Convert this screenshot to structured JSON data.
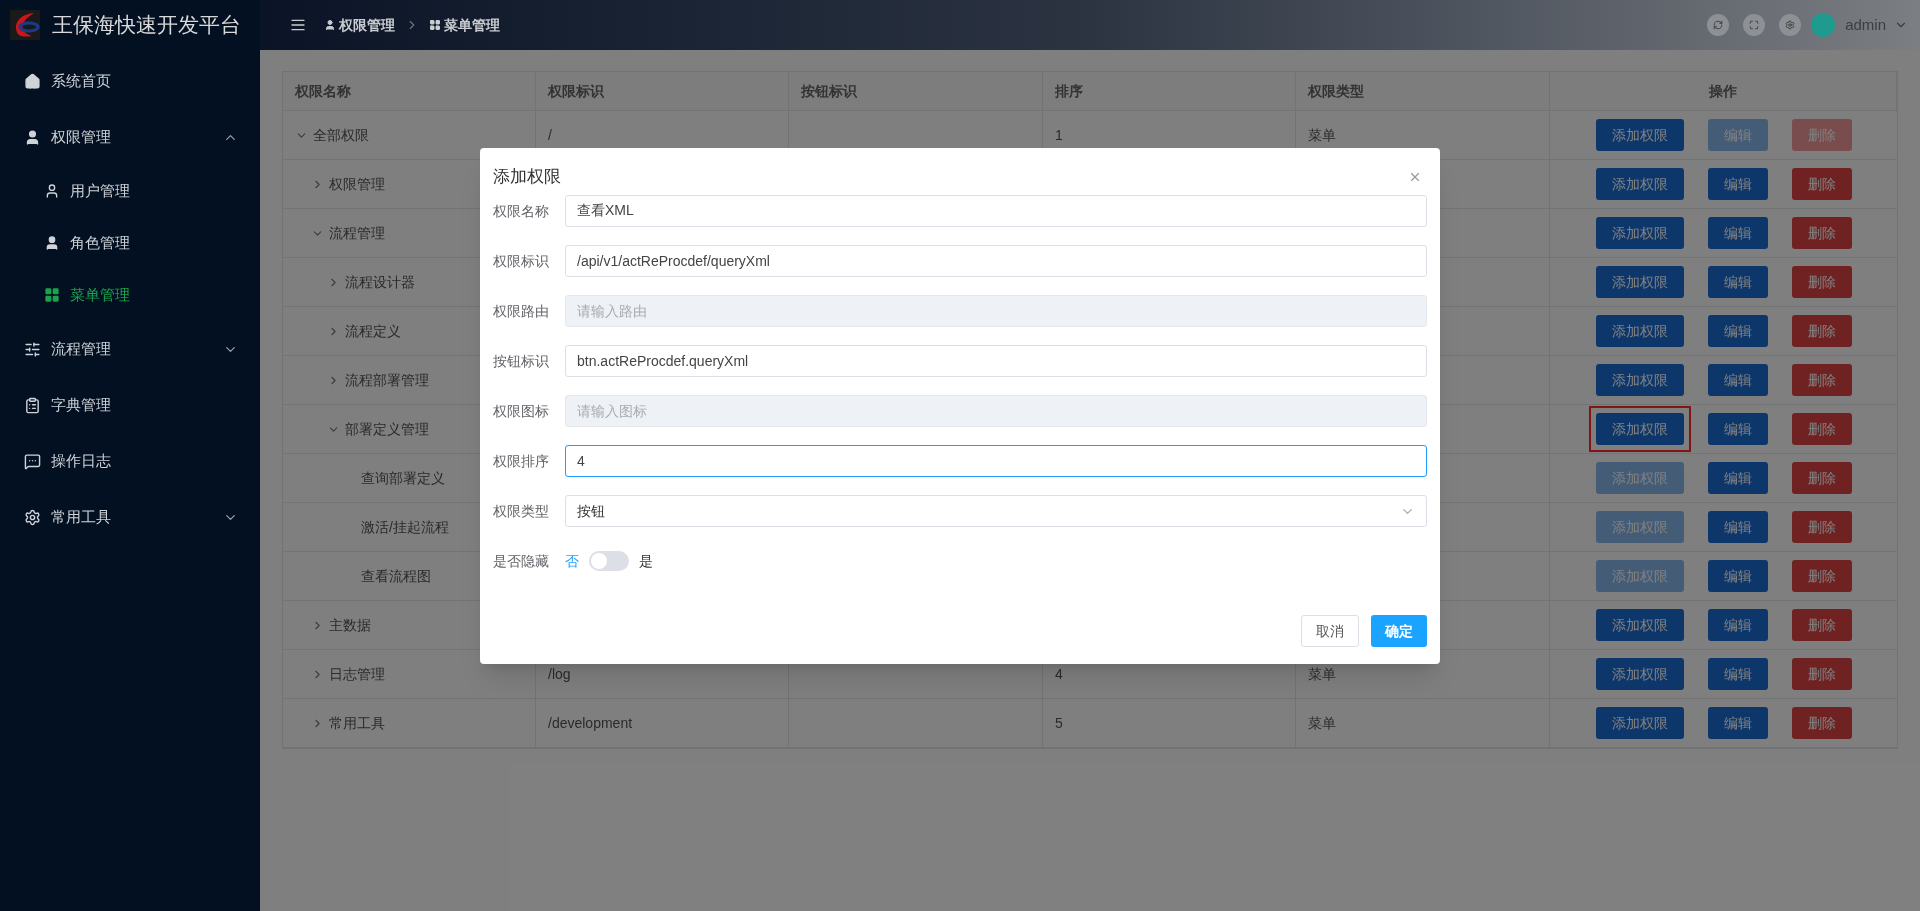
{
  "app": {
    "title": "王保海快速开发平台"
  },
  "header": {
    "breadcrumb": [
      {
        "label": "权限管理"
      },
      {
        "label": "菜单管理"
      }
    ],
    "user": {
      "name": "admin"
    }
  },
  "sidebar": {
    "items": [
      {
        "label": "系统首页",
        "selected": false
      },
      {
        "label": "权限管理",
        "selected": false,
        "expanded": true,
        "children": [
          {
            "label": "用户管理",
            "selected": false
          },
          {
            "label": "角色管理",
            "selected": false
          },
          {
            "label": "菜单管理",
            "selected": true
          }
        ]
      },
      {
        "label": "流程管理",
        "selected": false,
        "expanded": false
      },
      {
        "label": "字典管理",
        "selected": false
      },
      {
        "label": "操作日志",
        "selected": false
      },
      {
        "label": "常用工具",
        "selected": false,
        "expanded": false
      }
    ]
  },
  "table": {
    "columns": [
      "权限名称",
      "权限标识",
      "按钮标识",
      "排序",
      "权限类型",
      "操作"
    ],
    "rows": [
      {
        "name": "全部权限",
        "expanded": true,
        "path": "/",
        "sort": "1",
        "type": "菜单",
        "actions": [
          {
            "label": "添加权限",
            "kind": "primary",
            "disabled": false,
            "highlighted": false
          },
          {
            "label": "编辑",
            "kind": "primary",
            "disabled": true,
            "highlighted": false
          },
          {
            "label": "删除",
            "kind": "danger",
            "disabled": true,
            "highlighted": false
          }
        ],
        "children": [
          {
            "name": "权限管理",
            "expanded": false,
            "actions": [
              {
                "label": "添加权限",
                "kind": "primary",
                "disabled": false,
                "highlighted": false
              },
              {
                "label": "编辑",
                "kind": "primary",
                "disabled": false,
                "highlighted": false
              },
              {
                "label": "删除",
                "kind": "danger",
                "disabled": false,
                "highlighted": false
              }
            ]
          },
          {
            "name": "流程管理",
            "expanded": true,
            "actions": [
              {
                "label": "添加权限",
                "kind": "primary",
                "disabled": false,
                "highlighted": false
              },
              {
                "label": "编辑",
                "kind": "primary",
                "disabled": false,
                "highlighted": false
              },
              {
                "label": "删除",
                "kind": "danger",
                "disabled": false,
                "highlighted": false
              }
            ],
            "children": [
              {
                "name": "流程设计器",
                "expanded": false,
                "actions": [
                  {
                    "label": "添加权限",
                    "kind": "primary",
                    "disabled": false,
                    "highlighted": false
                  },
                  {
                    "label": "编辑",
                    "kind": "primary",
                    "disabled": false,
                    "highlighted": false
                  },
                  {
                    "label": "删除",
                    "kind": "danger",
                    "disabled": false,
                    "highlighted": false
                  }
                ]
              },
              {
                "name": "流程定义",
                "expanded": false,
                "actions": [
                  {
                    "label": "添加权限",
                    "kind": "primary",
                    "disabled": false,
                    "highlighted": false
                  },
                  {
                    "label": "编辑",
                    "kind": "primary",
                    "disabled": false,
                    "highlighted": false
                  },
                  {
                    "label": "删除",
                    "kind": "danger",
                    "disabled": false,
                    "highlighted": false
                  }
                ]
              },
              {
                "name": "流程部署管理",
                "expanded": false,
                "actions": [
                  {
                    "label": "添加权限",
                    "kind": "primary",
                    "disabled": false,
                    "highlighted": false
                  },
                  {
                    "label": "编辑",
                    "kind": "primary",
                    "disabled": false,
                    "highlighted": false
                  },
                  {
                    "label": "删除",
                    "kind": "danger",
                    "disabled": false,
                    "highlighted": false
                  }
                ]
              },
              {
                "name": "部署定义管理",
                "expanded": true,
                "actions": [
                  {
                    "label": "添加权限",
                    "kind": "primary",
                    "disabled": false,
                    "highlighted": true
                  },
                  {
                    "label": "编辑",
                    "kind": "primary",
                    "disabled": false,
                    "highlighted": false
                  },
                  {
                    "label": "删除",
                    "kind": "danger",
                    "disabled": false,
                    "highlighted": false
                  }
                ],
                "children": [
                  {
                    "name": "查询部署定义",
                    "actions": [
                      {
                        "label": "添加权限",
                        "kind": "primary",
                        "disabled": true,
                        "highlighted": false
                      },
                      {
                        "label": "编辑",
                        "kind": "primary",
                        "disabled": false,
                        "highlighted": false
                      },
                      {
                        "label": "删除",
                        "kind": "danger",
                        "disabled": false,
                        "highlighted": false
                      }
                    ]
                  },
                  {
                    "name": "激活/挂起流程",
                    "actions": [
                      {
                        "label": "添加权限",
                        "kind": "primary",
                        "disabled": true,
                        "highlighted": false
                      },
                      {
                        "label": "编辑",
                        "kind": "primary",
                        "disabled": false,
                        "highlighted": false
                      },
                      {
                        "label": "删除",
                        "kind": "danger",
                        "disabled": false,
                        "highlighted": false
                      }
                    ]
                  },
                  {
                    "name": "查看流程图",
                    "actions": [
                      {
                        "label": "添加权限",
                        "kind": "primary",
                        "disabled": true,
                        "highlighted": false
                      },
                      {
                        "label": "编辑",
                        "kind": "primary",
                        "disabled": false,
                        "highlighted": false
                      },
                      {
                        "label": "删除",
                        "kind": "danger",
                        "disabled": false,
                        "highlighted": false
                      }
                    ]
                  }
                ]
              }
            ]
          },
          {
            "name": "主数据",
            "expanded": false,
            "actions": [
              {
                "label": "添加权限",
                "kind": "primary",
                "disabled": false,
                "highlighted": false
              },
              {
                "label": "编辑",
                "kind": "primary",
                "disabled": false,
                "highlighted": false
              },
              {
                "label": "删除",
                "kind": "danger",
                "disabled": false,
                "highlighted": false
              }
            ]
          },
          {
            "name": "日志管理",
            "expanded": false,
            "path": "/log",
            "sort": "4",
            "type": "菜单",
            "actions": [
              {
                "label": "添加权限",
                "kind": "primary",
                "disabled": false,
                "highlighted": false
              },
              {
                "label": "编辑",
                "kind": "primary",
                "disabled": false,
                "highlighted": false
              },
              {
                "label": "删除",
                "kind": "danger",
                "disabled": false,
                "highlighted": false
              }
            ]
          },
          {
            "name": "常用工具",
            "expanded": false,
            "path": "/development",
            "sort": "5",
            "type": "菜单",
            "actions": [
              {
                "label": "添加权限",
                "kind": "primary",
                "disabled": false,
                "highlighted": false
              },
              {
                "label": "编辑",
                "kind": "primary",
                "disabled": false,
                "highlighted": false
              },
              {
                "label": "删除",
                "kind": "danger",
                "disabled": false,
                "highlighted": false
              }
            ]
          }
        ]
      }
    ]
  },
  "dialog": {
    "title": "添加权限",
    "fields": [
      {
        "label": "权限名称",
        "kind": "input",
        "value": "查看XML",
        "disabled": false,
        "focused": false
      },
      {
        "label": "权限标识",
        "kind": "input",
        "value": "/api/v1/actReProcdef/queryXml",
        "disabled": false,
        "focused": false
      },
      {
        "label": "权限路由",
        "kind": "input",
        "placeholder": "请输入路由",
        "disabled": true,
        "focused": false
      },
      {
        "label": "按钮标识",
        "kind": "input",
        "value": "btn.actReProcdef.queryXml",
        "disabled": false,
        "focused": false
      },
      {
        "label": "权限图标",
        "kind": "input",
        "placeholder": "请输入图标",
        "disabled": true,
        "focused": false
      },
      {
        "label": "权限排序",
        "kind": "input",
        "value": "4",
        "disabled": false,
        "focused": true
      },
      {
        "label": "权限类型",
        "kind": "select",
        "value": "按钮"
      },
      {
        "label": "是否隐藏",
        "kind": "switch",
        "off_text": "否",
        "on_text": "是",
        "on": false
      }
    ],
    "buttons": [
      {
        "label": "取消",
        "kind": "default"
      },
      {
        "label": "确定",
        "kind": "primary"
      }
    ]
  }
}
